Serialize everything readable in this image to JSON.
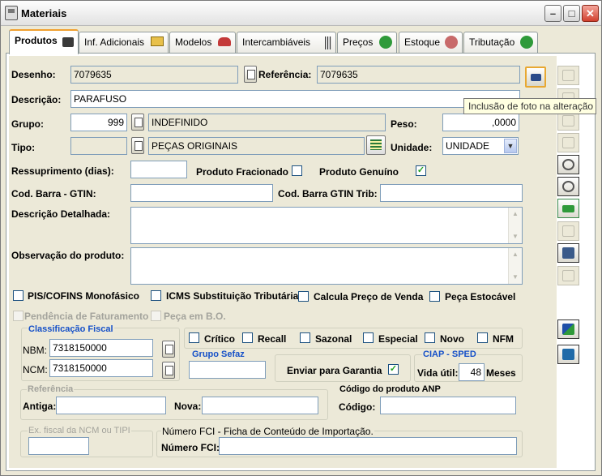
{
  "window": {
    "title": "Materiais"
  },
  "tabs": [
    {
      "label": "Produtos",
      "icon": "cart-icon"
    },
    {
      "label": "Inf. Adicionais",
      "icon": "folder-icon"
    },
    {
      "label": "Modelos",
      "icon": "car-icon"
    },
    {
      "label": "Intercambiáveis",
      "icon": "barcode-icon"
    },
    {
      "label": "Preços",
      "icon": "money-bag-icon"
    },
    {
      "label": "Estoque",
      "icon": "boxes-icon"
    },
    {
      "label": "Tributação",
      "icon": "money-bag-icon"
    }
  ],
  "form": {
    "desenho": {
      "label": "Desenho:",
      "value": "7079635"
    },
    "referencia": {
      "label": "Referência:",
      "value": "7079635"
    },
    "descricao": {
      "label": "Descrição:",
      "value": "PARAFUSO"
    },
    "grupo": {
      "label": "Grupo:",
      "code": "999",
      "name": "INDEFINIDO"
    },
    "peso": {
      "label": "Peso:",
      "value": ",0000"
    },
    "tipo": {
      "label": "Tipo:",
      "code": "",
      "name": "PEÇAS ORIGINAIS"
    },
    "unidade": {
      "label": "Unidade:",
      "value": "UNIDADE"
    },
    "ressuprimento": {
      "label": "Ressuprimento (dias):",
      "value": ""
    },
    "produto_fracionado": {
      "label": "Produto Fracionado",
      "checked": false
    },
    "produto_genuino": {
      "label": "Produto Genuíno",
      "checked": true,
      "mark": "✓"
    },
    "cod_barra_gtin": {
      "label": "Cod. Barra - GTIN:",
      "value": ""
    },
    "cod_barra_gtin_trib": {
      "label": "Cod. Barra GTIN Trib:",
      "value": ""
    },
    "descricao_detalhada": {
      "label": "Descrição Detalhada:",
      "value": ""
    },
    "observacao": {
      "label": "Observação do produto:",
      "value": ""
    },
    "pis_cofins": {
      "label": "PIS/COFINS Monofásico",
      "checked": false
    },
    "icms_st": {
      "label": "ICMS Substituição Tributária",
      "checked": false
    },
    "calcula_preco": {
      "label": "Calcula Preço de Venda",
      "checked": false
    },
    "peca_estocavel": {
      "label": "Peça Estocável",
      "checked": false
    },
    "pendencia_faturamento": {
      "label": "Pendência de Faturamento",
      "checked": false
    },
    "peca_bo": {
      "label": "Peça em B.O.",
      "checked": false
    }
  },
  "classificacao_fiscal": {
    "title": "Classificação Fiscal",
    "nbm_label": "NBM:",
    "nbm_value": "7318150000",
    "ncm_label": "NCM:",
    "ncm_value": "7318150000"
  },
  "flags": [
    {
      "label": "Crítico",
      "checked": false
    },
    {
      "label": "Recall",
      "checked": false
    },
    {
      "label": "Sazonal",
      "checked": false
    },
    {
      "label": "Especial",
      "checked": false
    },
    {
      "label": "Novo",
      "checked": false
    },
    {
      "label": "NFM",
      "checked": false
    }
  ],
  "grupo_sefaz": {
    "title": "Grupo Sefaz",
    "value": ""
  },
  "garantia": {
    "label": "Enviar para Garantia",
    "checked": true,
    "mark": "✓"
  },
  "ciap": {
    "title": "CIAP - SPED",
    "vida_label": "Vida útil:",
    "vida_value": "48",
    "meses_label": "Meses"
  },
  "referencia_grp": {
    "title": "Referência",
    "antiga_label": "Antiga:",
    "antiga_value": "",
    "nova_label": "Nova:",
    "nova_value": ""
  },
  "anp": {
    "title": "Código do produto ANP",
    "codigo_label": "Código:",
    "codigo_value": ""
  },
  "ex_fiscal": {
    "title": "Ex. fiscal da NCM ou TIPI",
    "value": ""
  },
  "fci": {
    "title": "Número  FCI - Ficha de Conteúdo de Importação.",
    "label": "Número FCI:",
    "value": ""
  },
  "tooltip": {
    "text": "Inclusão de foto na alteração"
  },
  "sidebar": [
    {
      "name": "insert-icon",
      "enabled": false,
      "color": "#b8b6aa"
    },
    {
      "name": "edit-icon",
      "enabled": false,
      "color": "#b8b6aa"
    },
    {
      "name": "eraser-icon",
      "enabled": false,
      "color": "#b8b6aa"
    },
    {
      "name": "preview-icon",
      "enabled": false,
      "color": "#b8b6aa"
    },
    {
      "name": "refresh-icon",
      "enabled": true,
      "color": "#555555"
    },
    {
      "name": "cancel-icon",
      "enabled": true,
      "color": "#555555"
    },
    {
      "name": "money-icon",
      "enabled": true,
      "color": "#1f8a3b"
    },
    {
      "name": "copy-icon",
      "enabled": false,
      "color": "#b8b6aa"
    },
    {
      "name": "print-icon",
      "enabled": true,
      "color": "#3a5a8a"
    },
    {
      "name": "check-icon",
      "enabled": false,
      "color": "#b8b6aa"
    },
    {
      "name": "confirm-icon",
      "enabled": true,
      "color": "#1f7a3b"
    },
    {
      "name": "exit-icon",
      "enabled": true,
      "color": "#1f6aa8"
    }
  ]
}
